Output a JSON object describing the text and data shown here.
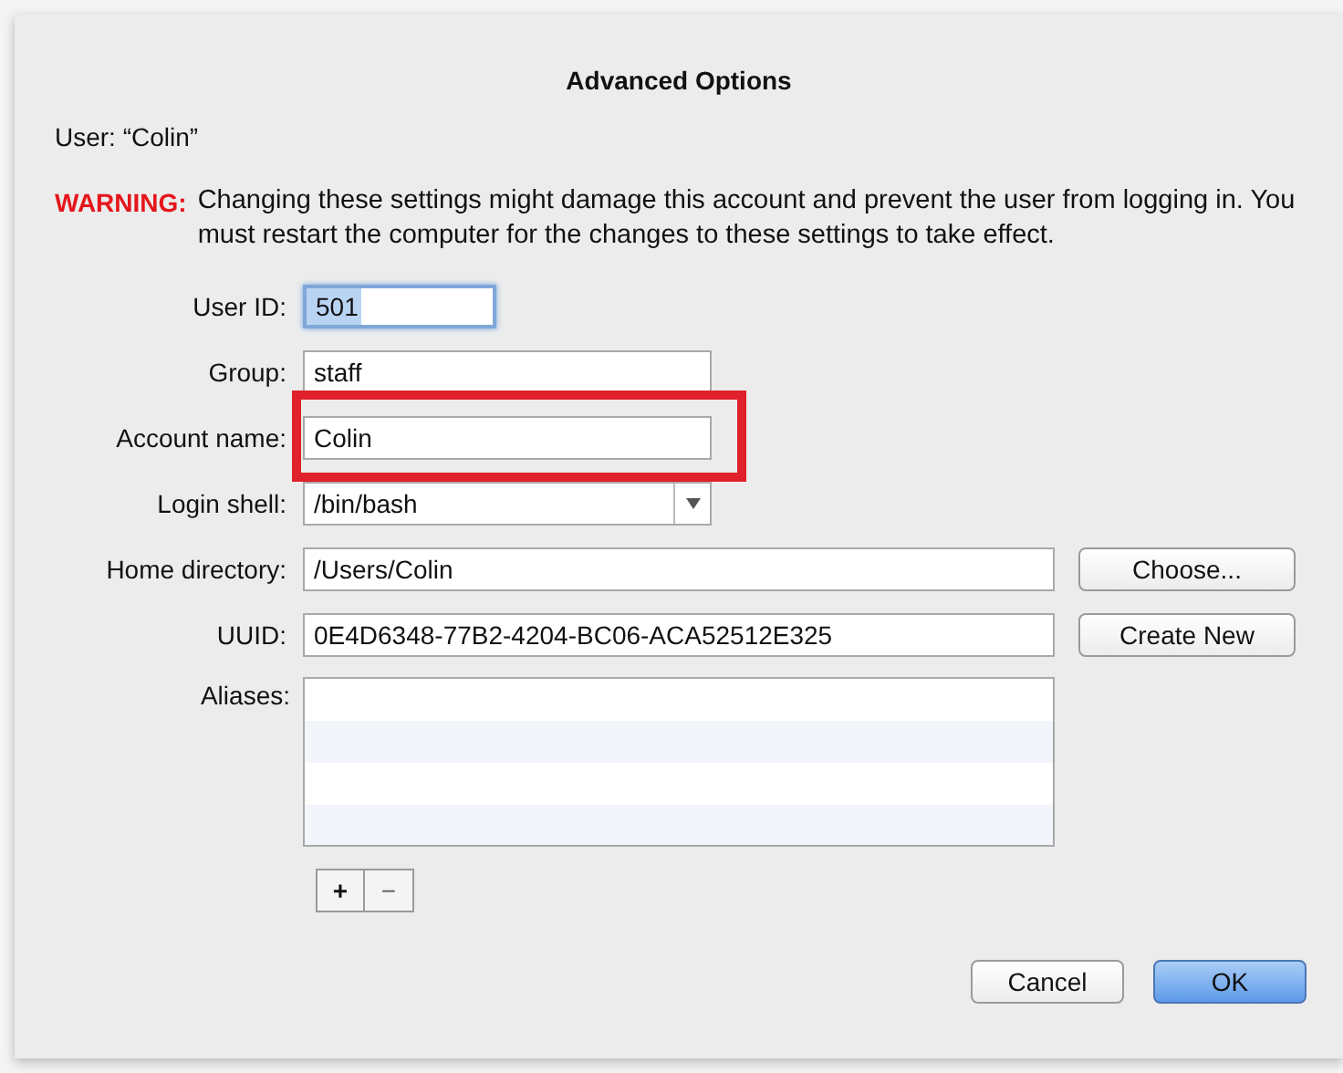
{
  "dialog": {
    "title": "Advanced Options",
    "user_line": "User: “Colin”",
    "warning_label": "WARNING:",
    "warning_text": "Changing these settings might damage this account and prevent the user from logging in. You must restart the computer for the changes to these settings to take effect."
  },
  "fields": [
    {
      "kind": "short",
      "label": "User ID:",
      "value": "501",
      "focused": true,
      "highlighted": false
    },
    {
      "kind": "text",
      "label": "Group:",
      "value": "staff",
      "focused": false,
      "highlighted": false
    },
    {
      "kind": "text",
      "label": "Account name:",
      "value": "Colin",
      "focused": false,
      "highlighted": true
    },
    {
      "kind": "combo",
      "label": "Login shell:",
      "value": "/bin/bash",
      "focused": false,
      "highlighted": false
    },
    {
      "kind": "wide",
      "label": "Home directory:",
      "value": "/Users/Colin",
      "focused": false,
      "highlighted": false,
      "button": "Choose..."
    },
    {
      "kind": "wide",
      "label": "UUID:",
      "value": "0E4D6348-77B2-4204-BC06-ACA52512E325",
      "focused": false,
      "highlighted": false,
      "button": "Create New"
    }
  ],
  "aliases": {
    "label": "Aliases:",
    "add": "+",
    "remove": "−"
  },
  "buttons": [
    {
      "label": "Cancel",
      "default": false
    },
    {
      "label": "OK",
      "default": true
    }
  ]
}
